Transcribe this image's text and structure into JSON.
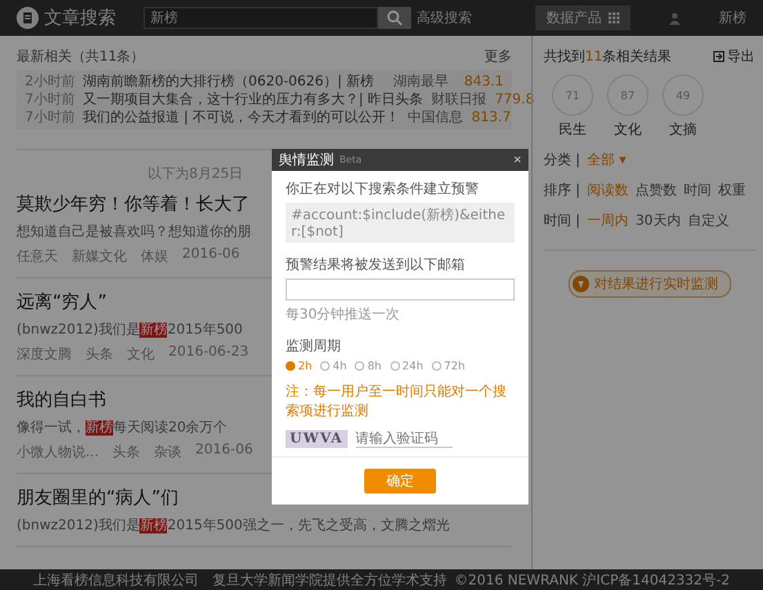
{
  "header": {
    "logo": "文章搜索",
    "search_value": "新榜",
    "advanced": "高级搜索",
    "product_button": "数据产品",
    "user": "新榜"
  },
  "hot": {
    "title": "最新相关（共11条）",
    "more": "更多",
    "rows": [
      {
        "time": "2小时前",
        "title": "湖南前瞻新榜的大排行榜（0620-0626）| 新榜",
        "account": "湖南最早",
        "score": "843.1"
      },
      {
        "time": "7小时前",
        "title": "又一期项目大集合，这十行业的压力有多大？| 昨日头条",
        "account": "财联日报",
        "score": "779.8"
      },
      {
        "time": "7小时前",
        "title": "我们的公益报道 | 不可说，今天才看到的可以公开！",
        "account": "中国信息",
        "score": "813.7"
      }
    ]
  },
  "divider": "以下为8月25日",
  "articles": [
    {
      "title": "莫欺少年穷！你等着！长大了",
      "excerpt": "想知道自己是被喜欢吗？想知道你的朋",
      "meta": [
        "任意天",
        "新媒文化",
        "体娱",
        "2016-06"
      ]
    },
    {
      "title": "远离“穷人”",
      "excerpt": "(bnwz2012)我们是**新榜**2015年500",
      "meta": [
        "深度文腾",
        "头条",
        "文化",
        "2016-06-23"
      ]
    },
    {
      "title": "我的自白书",
      "excerpt": "像得一试，**新榜**每天阅读20余万个",
      "meta": [
        "小微人物说...",
        "头条",
        "杂谈",
        "2016-06"
      ]
    },
    {
      "title": "朋友圈里的“病人”们",
      "excerpt": "(bnwz2012)我们是**新榜**2015年500强之一，先飞之受高，文腾之熠光"
    }
  ],
  "side": {
    "found_prefix": "共找到",
    "found_count": "11",
    "found_suffix": "条相关结果",
    "export": "导出",
    "circles": [
      {
        "value": "71",
        "label": "民生"
      },
      {
        "value": "87",
        "label": "文化"
      },
      {
        "value": "49",
        "label": "文摘"
      }
    ],
    "filters": [
      {
        "label": "分类 |",
        "options": [
          {
            "text": "全部 ▾",
            "selected": true
          }
        ]
      },
      {
        "label": "排序 |",
        "options": [
          {
            "text": "阅读数",
            "selected": true
          },
          {
            "text": "点赞数",
            "selected": false
          },
          {
            "text": "时间",
            "selected": false
          },
          {
            "text": "权重",
            "selected": false
          }
        ]
      },
      {
        "label": "时间 |",
        "options": [
          {
            "text": "一周内",
            "selected": true
          },
          {
            "text": "30天内",
            "selected": false
          },
          {
            "text": "自定义",
            "selected": false
          }
        ]
      }
    ],
    "monitor_button": "对结果进行实时监测"
  },
  "modal": {
    "title": "舆情监测",
    "badge": "Beta",
    "close": "×",
    "condition_label": "你正在对以下搜索条件建立预警",
    "condition": "#account:$include(新榜)&either:[$not]",
    "email_label": "预警结果将被发送到以下邮箱",
    "email_hint": "每30分钟推送一次",
    "period_label": "监测周期",
    "periods": [
      {
        "label": "2h",
        "selected": true
      },
      {
        "label": "4h",
        "selected": false
      },
      {
        "label": "8h",
        "selected": false
      },
      {
        "label": "24h",
        "selected": false
      },
      {
        "label": "72h",
        "selected": false
      }
    ],
    "note": "注：每一用户至一时间只能对一个搜索项进行监测",
    "captcha": "UWVA",
    "captcha_placeholder": "请输入验证码",
    "confirm": "确定"
  },
  "footer": {
    "left": "上海看榜信息科技有限公司　复旦大学新闻学院提供全方位学术支持",
    "right": "©2016 NEWRANK 沪ICP备14042332号-2"
  }
}
